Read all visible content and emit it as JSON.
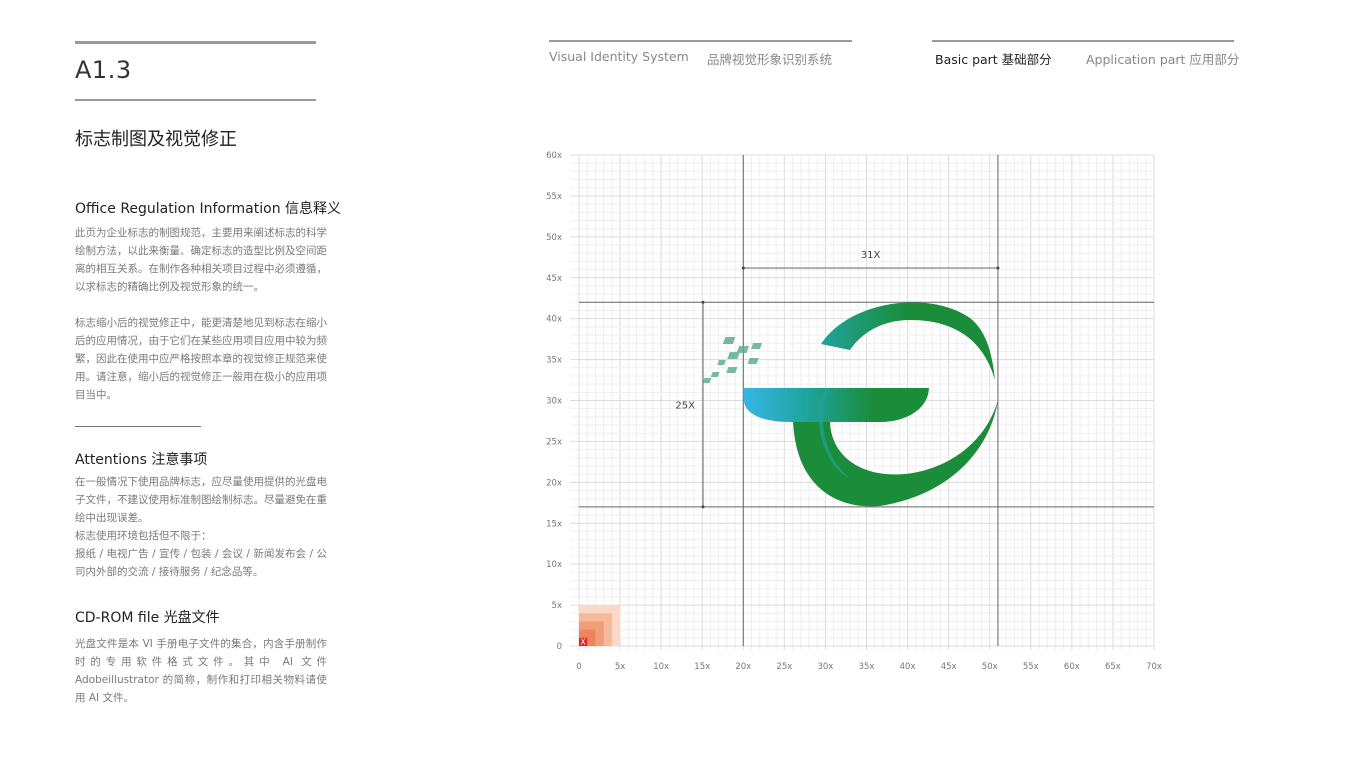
{
  "page": {
    "code": "A1.3",
    "title": "标志制图及视觉修正"
  },
  "header": {
    "system_en": "Visual Identity System",
    "system_cn": "品牌视觉形象识别系统",
    "basic_part": "Basic part  基础部分",
    "application_part": "Application part  应用部分",
    "active": "basic_part"
  },
  "sections": {
    "regulation": {
      "heading": "Office Regulation Information 信息释义",
      "para1": "此页为企业标志的制图规范，主要用来阐述标志的科学绘制方法，以此来衡量、确定标志的造型比例及空间距离的相互关系。在制作各种相关项目过程中必须遵循，以求标志的精确比例及视觉形象的统一。",
      "para2": "标志缩小后的视觉修正中，能更清楚地见到标志在缩小后的应用情况，由于它们在某些应用项目应用中较为频繁，因此在使用中应严格按照本章的视觉修正规范来使用。请注意，缩小后的视觉修正一般用在极小的应用项目当中。"
    },
    "attentions": {
      "heading": "Attentions 注意事项",
      "para1": "在一般情况下使用品牌标志，应尽量使用提供的光盘电子文件，不建议使用标准制图绘制标志。尽量避免在重绘中出现误差。",
      "para2": "标志使用环境包括但不限于：",
      "para3": "报纸 / 电视广告 / 宣传 / 包装 / 会议 / 新闻发布会 / 公司内外部的交流 / 接待服务 / 纪念品等。"
    },
    "cdrom": {
      "heading": "CD-ROM file 光盘文件",
      "para1": "光盘文件是本 VI 手册电子文件的集合，内含手册制作时的专用软件格式文件。其中 AI 文件 Adobeillustrator 的简称，制作和打印相关物料请使用 AI 文件。"
    }
  },
  "construction_grid": {
    "x_range": [
      0,
      70
    ],
    "y_range": [
      0,
      60
    ],
    "x_ticks": [
      "0",
      "5x",
      "10x",
      "15x",
      "20x",
      "25x",
      "30x",
      "35x",
      "40x",
      "45x",
      "50x",
      "55x",
      "60x",
      "65x",
      "70x"
    ],
    "y_ticks": [
      "0",
      "5x",
      "10x",
      "15x",
      "20x",
      "25x",
      "30x",
      "35x",
      "40x",
      "45x",
      "50x",
      "55x",
      "60x"
    ],
    "guide_x": [
      20,
      51
    ],
    "guide_y": [
      17,
      42
    ],
    "width_label": "31X",
    "height_label": "25X",
    "unit_label": "X",
    "unit_color": "#e8231e",
    "logo_colors": {
      "green": "#1a8c3a",
      "teal": "#1fa39a",
      "cyan": "#35b6e6"
    }
  }
}
